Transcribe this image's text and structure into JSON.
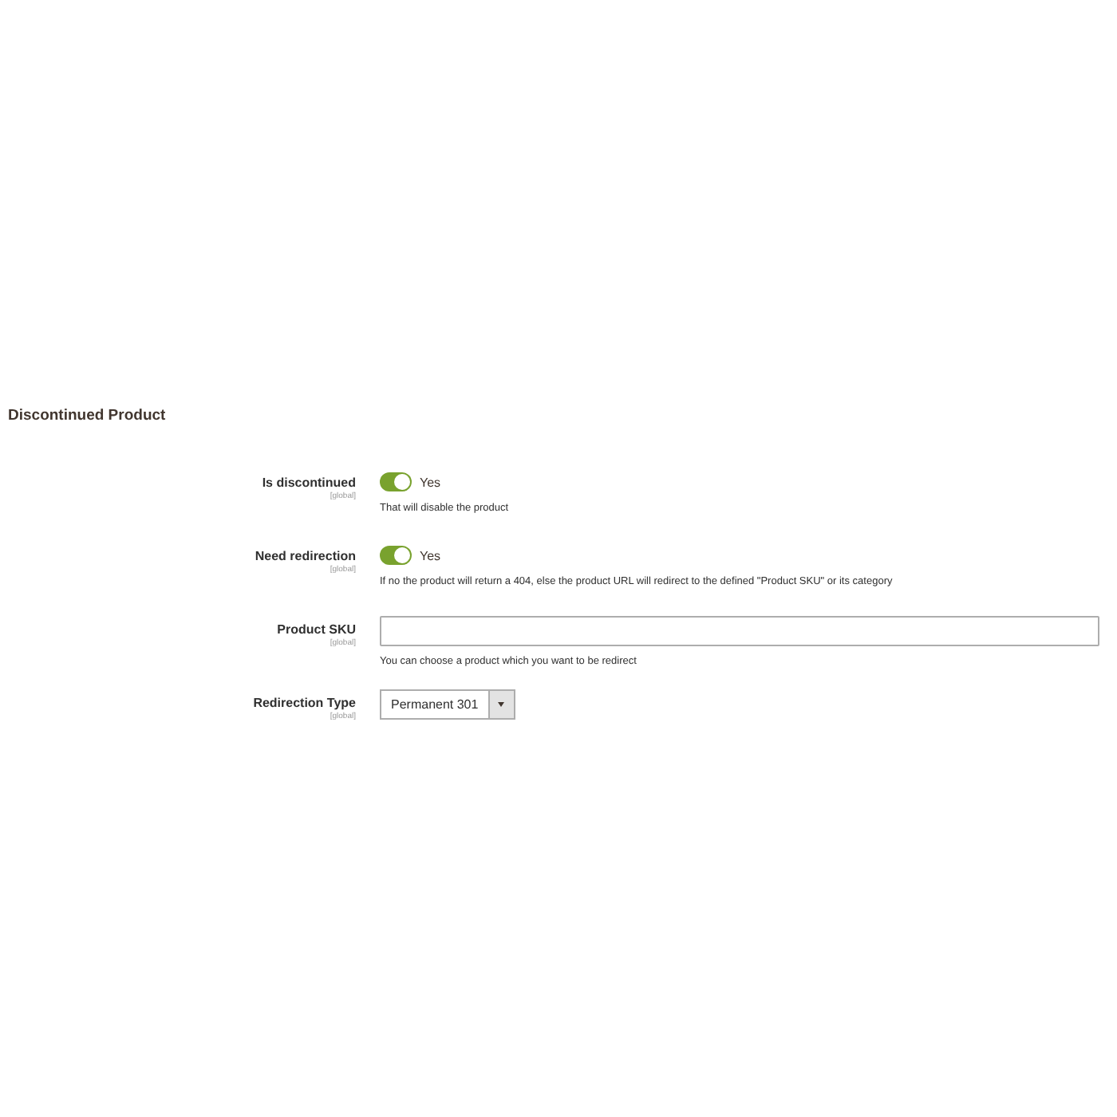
{
  "section": {
    "title": "Discontinued Product"
  },
  "fields": [
    {
      "kind": "toggle",
      "label": "Is discontinued",
      "scope": "[global]",
      "on": true,
      "value": "Yes",
      "note": "That will disable the product"
    },
    {
      "kind": "toggle",
      "label": "Need redirection",
      "scope": "[global]",
      "on": true,
      "value": "Yes",
      "note": "If no the product will return a 404, else the product URL will redirect to the defined \"Product SKU\" or its category"
    },
    {
      "kind": "text",
      "label": "Product SKU",
      "scope": "[global]",
      "note": "You can choose a product which you want to be redirect"
    },
    {
      "kind": "select",
      "label": "Redirection Type",
      "scope": "[global]",
      "value": "Permanent 301"
    }
  ]
}
